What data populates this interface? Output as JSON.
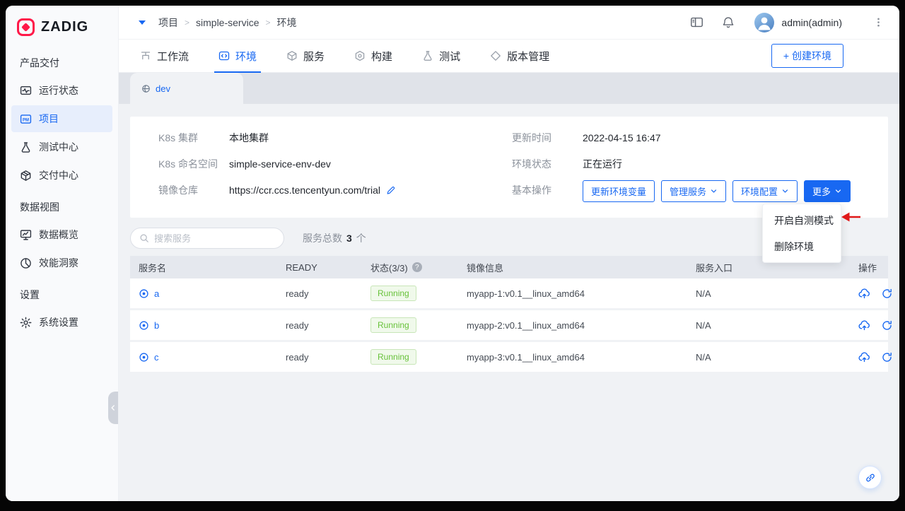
{
  "colors": {
    "primary": "#1868f2",
    "logo_red": "#ff1949",
    "success": "#67c23a",
    "arrow_red": "#e01818"
  },
  "sidebar": {
    "logo": "ZADIG",
    "sections": [
      {
        "title": "产品交付",
        "items": [
          {
            "label": "运行状态"
          },
          {
            "label": "项目"
          },
          {
            "label": "测试中心"
          },
          {
            "label": "交付中心"
          }
        ]
      },
      {
        "title": "数据视图",
        "items": [
          {
            "label": "数据概览"
          },
          {
            "label": "效能洞察"
          }
        ]
      },
      {
        "title": "设置",
        "items": [
          {
            "label": "系统设置"
          }
        ]
      }
    ]
  },
  "header": {
    "breadcrumb": [
      "项目",
      "simple-service",
      "环境"
    ],
    "separator": ">",
    "username": "admin(admin)"
  },
  "nav": {
    "tabs": [
      "工作流",
      "环境",
      "服务",
      "构建",
      "测试",
      "版本管理"
    ],
    "active_tab": "环境",
    "create_button": "+ 创建环境"
  },
  "env": {
    "tab": "dev",
    "info": {
      "k8s_cluster_label": "K8s 集群",
      "k8s_cluster": "本地集群",
      "namespace_label": "K8s 命名空间",
      "namespace": "simple-service-env-dev",
      "registry_label": "镜像仓库",
      "registry": "https://ccr.ccs.tencentyun.com/trial",
      "update_time_label": "更新时间",
      "update_time": "2022-04-15 16:47",
      "status_label": "环境状态",
      "status": "正在运行",
      "ops_label": "基本操作"
    },
    "actions": {
      "update_vars": "更新环境变量",
      "manage_services": "管理服务",
      "env_config": "环境配置",
      "more": "更多"
    },
    "more_menu": [
      "开启自测模式",
      "删除环境"
    ]
  },
  "toolbar": {
    "search_placeholder": "搜索服务",
    "total_label": "服务总数",
    "total_count": "3",
    "total_unit": "个"
  },
  "table": {
    "headers": [
      "服务名",
      "READY",
      "状态(3/3)",
      "镜像信息",
      "服务入口",
      "操作"
    ],
    "rows": [
      {
        "name": "a",
        "ready": "ready",
        "status": "Running",
        "image": "myapp-1:v0.1__linux_amd64",
        "entry": "N/A"
      },
      {
        "name": "b",
        "ready": "ready",
        "status": "Running",
        "image": "myapp-2:v0.1__linux_amd64",
        "entry": "N/A"
      },
      {
        "name": "c",
        "ready": "ready",
        "status": "Running",
        "image": "myapp-3:v0.1__linux_amd64",
        "entry": "N/A"
      }
    ]
  },
  "icons": {
    "help": "?"
  }
}
